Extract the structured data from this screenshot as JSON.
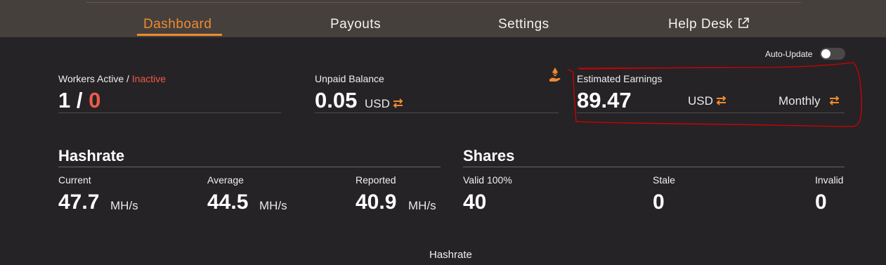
{
  "nav": {
    "tabs": [
      {
        "label": "Dashboard",
        "active": true
      },
      {
        "label": "Payouts",
        "active": false
      },
      {
        "label": "Settings",
        "active": false
      },
      {
        "label": "Help Desk",
        "active": false
      }
    ]
  },
  "auto_update": {
    "label": "Auto-Update",
    "enabled": false
  },
  "workers": {
    "label_active": "Workers Active /",
    "label_inactive": "Inactive",
    "active": "1",
    "separator": "/",
    "inactive": "0"
  },
  "unpaid_balance": {
    "label": "Unpaid Balance",
    "value": "0.05",
    "currency": "USD"
  },
  "estimated_earnings": {
    "label": "Estimated Earnings",
    "value": "89.47",
    "currency": "USD",
    "period": "Monthly"
  },
  "hashrate": {
    "title": "Hashrate",
    "current": {
      "label": "Current",
      "value": "47.7",
      "unit": "MH/s"
    },
    "average": {
      "label": "Average",
      "value": "44.5",
      "unit": "MH/s"
    },
    "reported": {
      "label": "Reported",
      "value": "40.9",
      "unit": "MH/s"
    }
  },
  "shares": {
    "title": "Shares",
    "valid": {
      "label": "Valid 100%",
      "value": "40"
    },
    "stale": {
      "label": "Stale",
      "value": "0"
    },
    "invalid": {
      "label": "Invalid",
      "value": "0"
    }
  },
  "chart_section": {
    "title": "Hashrate"
  },
  "colors": {
    "accent": "#ef8a2f",
    "inactive": "#f05a4a",
    "background": "#252326",
    "nav_background": "#46403d",
    "annotation": "#d40000"
  },
  "icons": [
    "external-link-icon",
    "swap-arrows-icon",
    "ethereum-payout-icon"
  ]
}
